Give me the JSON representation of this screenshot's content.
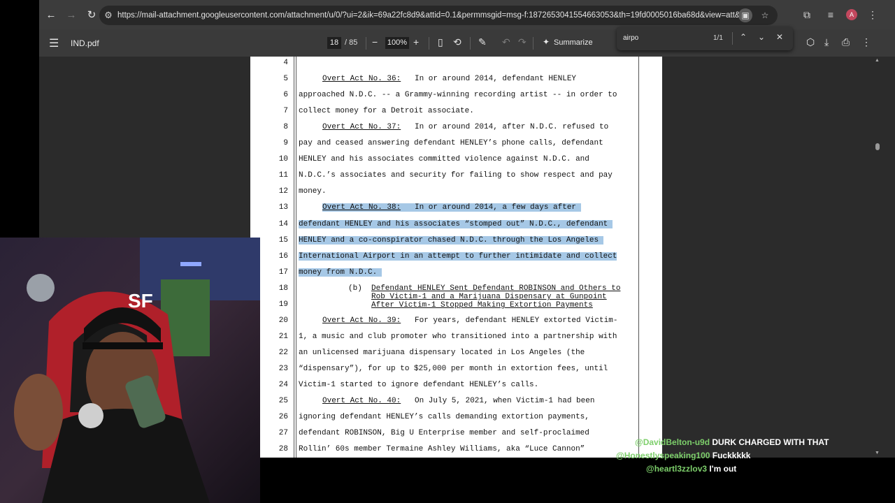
{
  "browser": {
    "url": "https://mail-attachment.googleusercontent.com/attachment/u/0/?ui=2&ik=69a22fc8d9&attid=0.1&permmsgid=msg-f:1872653041554663053&th=19fd0005016ba68d&view=att&disp=inline&realattid...",
    "profile_initial": "A"
  },
  "pdf_toolbar": {
    "title": "IND.pdf",
    "current_page": "18",
    "total_pages": "/ 85",
    "zoom": "100%",
    "summarize_label": "Summarize"
  },
  "find": {
    "query": "airpo",
    "count": "1/1"
  },
  "document": {
    "lines": [
      {
        "n": "4",
        "text": ""
      },
      {
        "n": "5",
        "label": "Overt Act No. 36:",
        "text": "   In or around 2014, defendant HENLEY"
      },
      {
        "n": "6",
        "text": "approached N.D.C. -- a Grammy-winning recording artist -- in order to"
      },
      {
        "n": "7",
        "text": "collect money for a Detroit associate."
      },
      {
        "n": "8",
        "label": "Overt Act No. 37:",
        "text": "   In or around 2014, after N.D.C. refused to"
      },
      {
        "n": "9",
        "text": "pay and ceased answering defendant HENLEY’s phone calls, defendant"
      },
      {
        "n": "10",
        "text": "HENLEY and his associates committed violence against N.D.C. and"
      },
      {
        "n": "11",
        "text": "N.D.C.’s associates and security for failing to show respect and pay"
      },
      {
        "n": "12",
        "text": "money."
      },
      {
        "n": "13",
        "label": "Overt Act No. 38:",
        "text": "   In or around 2014, a few days after "
      },
      {
        "n": "14",
        "text": "defendant HENLEY and his associates “stomped out” N.D.C., defendant "
      },
      {
        "n": "15",
        "text": "HENLEY and a co-conspirator chased N.D.C. through the Los Angeles "
      },
      {
        "n": "16",
        "text": "International Airport in an attempt to further intimidate and collect"
      },
      {
        "n": "17",
        "text": "money from N.D.C. "
      },
      {
        "n": "18",
        "text": ""
      },
      {
        "n": "19",
        "text": ""
      },
      {
        "n": "20",
        "label": "Overt Act No. 39:",
        "text": "   For years, defendant HENLEY extorted Victim-"
      },
      {
        "n": "21",
        "text": "1, a music and club promoter who transitioned into a partnership with"
      },
      {
        "n": "22",
        "text": "an unlicensed marijuana dispensary located in Los Angeles (the"
      },
      {
        "n": "23",
        "text": "“dispensary”), for up to $25,000 per month in extortion fees, until"
      },
      {
        "n": "24",
        "text": "Victim-1 started to ignore defendant HENLEY’s calls."
      },
      {
        "n": "25",
        "label": "Overt Act No. 40:",
        "text": "   On July 5, 2021, when Victim-1 had been"
      },
      {
        "n": "26",
        "text": "ignoring defendant HENLEY’s calls demanding extortion payments,"
      },
      {
        "n": "27",
        "text": "defendant ROBINSON, Big U Enterprise member and self-proclaimed"
      },
      {
        "n": "28",
        "text": "Rollin’ 60s member Termaine Ashley Williams, aka “Luce Cannon”"
      }
    ],
    "heading_marker": "(b)",
    "heading_lines": [
      "Defendant HENLEY Sent Defendant ROBINSON and Others to",
      "Rob Victim-1 and a Marijuana Dispensary at Gunpoint",
      "After Victim-1 Stopped Making Extortion Payments"
    ]
  },
  "chat": [
    {
      "user": "@DavidBelton-u9d",
      "message": "DURK CHARGED WITH THAT"
    },
    {
      "user": "@Honestlyspeaking100",
      "message": "Fuckkkkk"
    },
    {
      "user": "@heartl3zzlov3",
      "message": "I'm out"
    }
  ],
  "colors": {
    "highlight": "#a6c8e6",
    "chat_user": "#7dcf6b",
    "toolbar_bg": "#3a3a3a",
    "viewer_bg": "#2b2b2b"
  }
}
